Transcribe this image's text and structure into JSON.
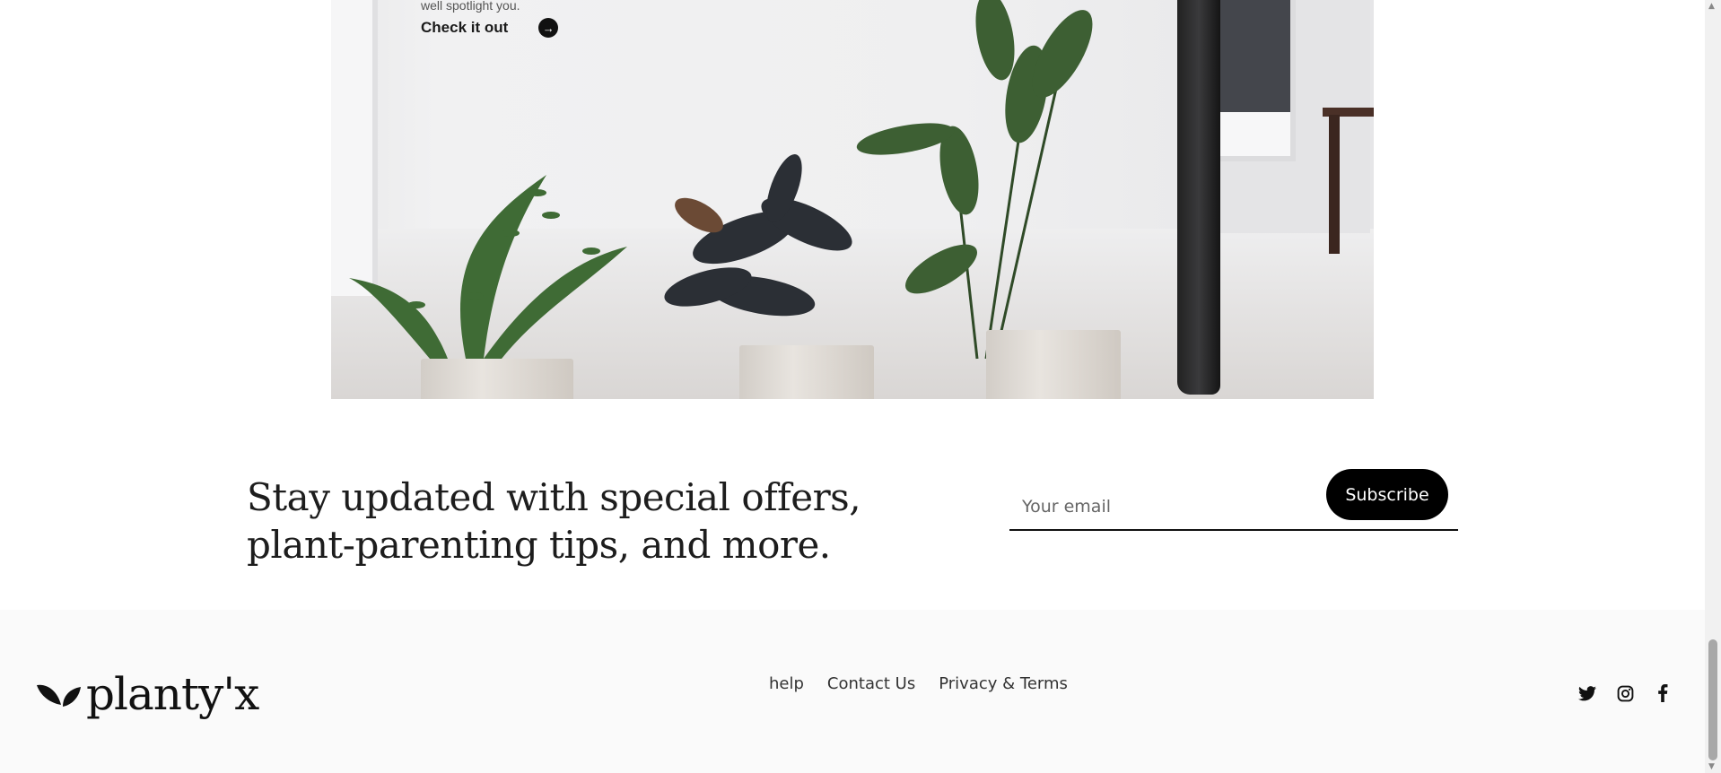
{
  "hero": {
    "subtitle": "well spotlight you.",
    "cta_label": "Check it out",
    "cta_icon": "arrow-right-icon"
  },
  "newsletter": {
    "title_line1": "Stay updated with special offers,",
    "title_line2": "plant-parenting tips, and more.",
    "email_placeholder": "Your email",
    "email_value": "",
    "subscribe_label": "Subscribe"
  },
  "footer": {
    "logo_text": "planty'x",
    "links": [
      {
        "label": "help"
      },
      {
        "label": "Contact Us"
      },
      {
        "label": "Privacy & Terms"
      }
    ],
    "social": [
      "twitter-icon",
      "instagram-icon",
      "facebook-icon"
    ]
  },
  "colors": {
    "button": "#000000",
    "footer_bg": "#fafafa"
  }
}
